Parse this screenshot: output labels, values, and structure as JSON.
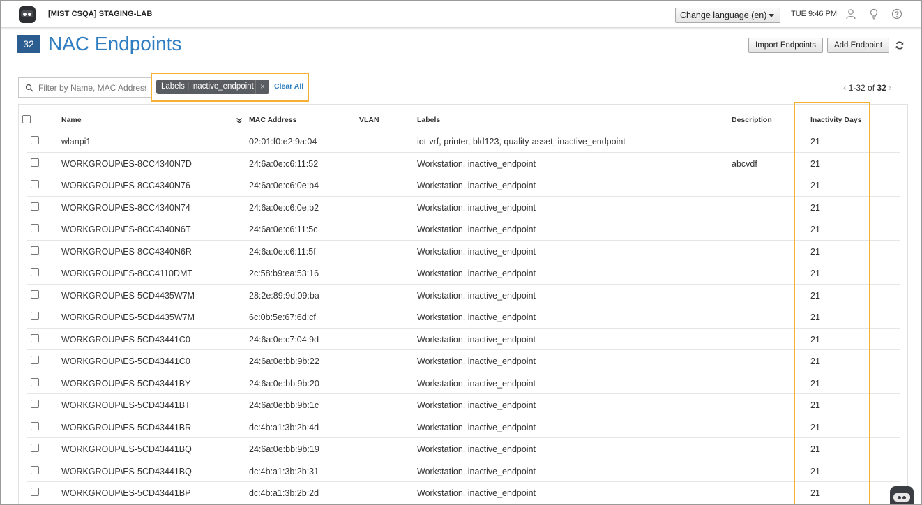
{
  "header": {
    "org_name": "[MIST CSQA] STAGING-LAB",
    "language_select": "Change language (en)",
    "clock": "TUE 9:46 PM"
  },
  "page": {
    "count": "32",
    "title": "NAC Endpoints",
    "import_label": "Import Endpoints",
    "add_label": "Add Endpoint"
  },
  "filter": {
    "search_placeholder": "Filter by Name, MAC Address",
    "chip_label": "Labels | inactive_endpoint",
    "chip_remove": "×",
    "clear_all": "Clear All"
  },
  "pager": {
    "range": "1-32 of",
    "total": "32",
    "prev": "‹",
    "next": "›"
  },
  "table": {
    "columns": {
      "name": "Name",
      "mac": "MAC Address",
      "vlan": "VLAN",
      "labels": "Labels",
      "description": "Description",
      "inactivity": "Inactivity Days"
    },
    "rows": [
      {
        "name": "wlanpi1",
        "mac": "02:01:f0:e2:9a:04",
        "vlan": "",
        "labels": "iot-vrf, printer, bld123, quality-asset, inactive_endpoint",
        "description": "",
        "inactivity": "21"
      },
      {
        "name": "WORKGROUP\\ES-8CC4340N7D",
        "mac": "24:6a:0e:c6:11:52",
        "vlan": "",
        "labels": "Workstation, inactive_endpoint",
        "description": "abcvdf",
        "inactivity": "21"
      },
      {
        "name": "WORKGROUP\\ES-8CC4340N76",
        "mac": "24:6a:0e:c6:0e:b4",
        "vlan": "",
        "labels": "Workstation, inactive_endpoint",
        "description": "",
        "inactivity": "21"
      },
      {
        "name": "WORKGROUP\\ES-8CC4340N74",
        "mac": "24:6a:0e:c6:0e:b2",
        "vlan": "",
        "labels": "Workstation, inactive_endpoint",
        "description": "",
        "inactivity": "21"
      },
      {
        "name": "WORKGROUP\\ES-8CC4340N6T",
        "mac": "24:6a:0e:c6:11:5c",
        "vlan": "",
        "labels": "Workstation, inactive_endpoint",
        "description": "",
        "inactivity": "21"
      },
      {
        "name": "WORKGROUP\\ES-8CC4340N6R",
        "mac": "24:6a:0e:c6:11:5f",
        "vlan": "",
        "labels": "Workstation, inactive_endpoint",
        "description": "",
        "inactivity": "21"
      },
      {
        "name": "WORKGROUP\\ES-8CC4110DMT",
        "mac": "2c:58:b9:ea:53:16",
        "vlan": "",
        "labels": "Workstation, inactive_endpoint",
        "description": "",
        "inactivity": "21"
      },
      {
        "name": "WORKGROUP\\ES-5CD4435W7M",
        "mac": "28:2e:89:9d:09:ba",
        "vlan": "",
        "labels": "Workstation, inactive_endpoint",
        "description": "",
        "inactivity": "21"
      },
      {
        "name": "WORKGROUP\\ES-5CD4435W7M",
        "mac": "6c:0b:5e:67:6d:cf",
        "vlan": "",
        "labels": "Workstation, inactive_endpoint",
        "description": "",
        "inactivity": "21"
      },
      {
        "name": "WORKGROUP\\ES-5CD43441C0",
        "mac": "24:6a:0e:c7:04:9d",
        "vlan": "",
        "labels": "Workstation, inactive_endpoint",
        "description": "",
        "inactivity": "21"
      },
      {
        "name": "WORKGROUP\\ES-5CD43441C0",
        "mac": "24:6a:0e:bb:9b:22",
        "vlan": "",
        "labels": "Workstation, inactive_endpoint",
        "description": "",
        "inactivity": "21"
      },
      {
        "name": "WORKGROUP\\ES-5CD43441BY",
        "mac": "24:6a:0e:bb:9b:20",
        "vlan": "",
        "labels": "Workstation, inactive_endpoint",
        "description": "",
        "inactivity": "21"
      },
      {
        "name": "WORKGROUP\\ES-5CD43441BT",
        "mac": "24:6a:0e:bb:9b:1c",
        "vlan": "",
        "labels": "Workstation, inactive_endpoint",
        "description": "",
        "inactivity": "21"
      },
      {
        "name": "WORKGROUP\\ES-5CD43441BR",
        "mac": "dc:4b:a1:3b:2b:4d",
        "vlan": "",
        "labels": "Workstation, inactive_endpoint",
        "description": "",
        "inactivity": "21"
      },
      {
        "name": "WORKGROUP\\ES-5CD43441BQ",
        "mac": "24:6a:0e:bb:9b:19",
        "vlan": "",
        "labels": "Workstation, inactive_endpoint",
        "description": "",
        "inactivity": "21"
      },
      {
        "name": "WORKGROUP\\ES-5CD43441BQ",
        "mac": "dc:4b:a1:3b:2b:31",
        "vlan": "",
        "labels": "Workstation, inactive_endpoint",
        "description": "",
        "inactivity": "21"
      },
      {
        "name": "WORKGROUP\\ES-5CD43441BP",
        "mac": "dc:4b:a1:3b:2b:2d",
        "vlan": "",
        "labels": "Workstation, inactive_endpoint",
        "description": "",
        "inactivity": "21"
      }
    ]
  },
  "colors": {
    "accent": "#2f7dc1",
    "badge": "#2b5d91",
    "highlight": "#f4b136",
    "chip": "#595c61"
  },
  "icons": [
    "mist-logo-icon",
    "user-icon",
    "lightbulb-icon",
    "help-icon",
    "refresh-icon",
    "search-icon",
    "sort-icon",
    "chat-bot-icon"
  ]
}
